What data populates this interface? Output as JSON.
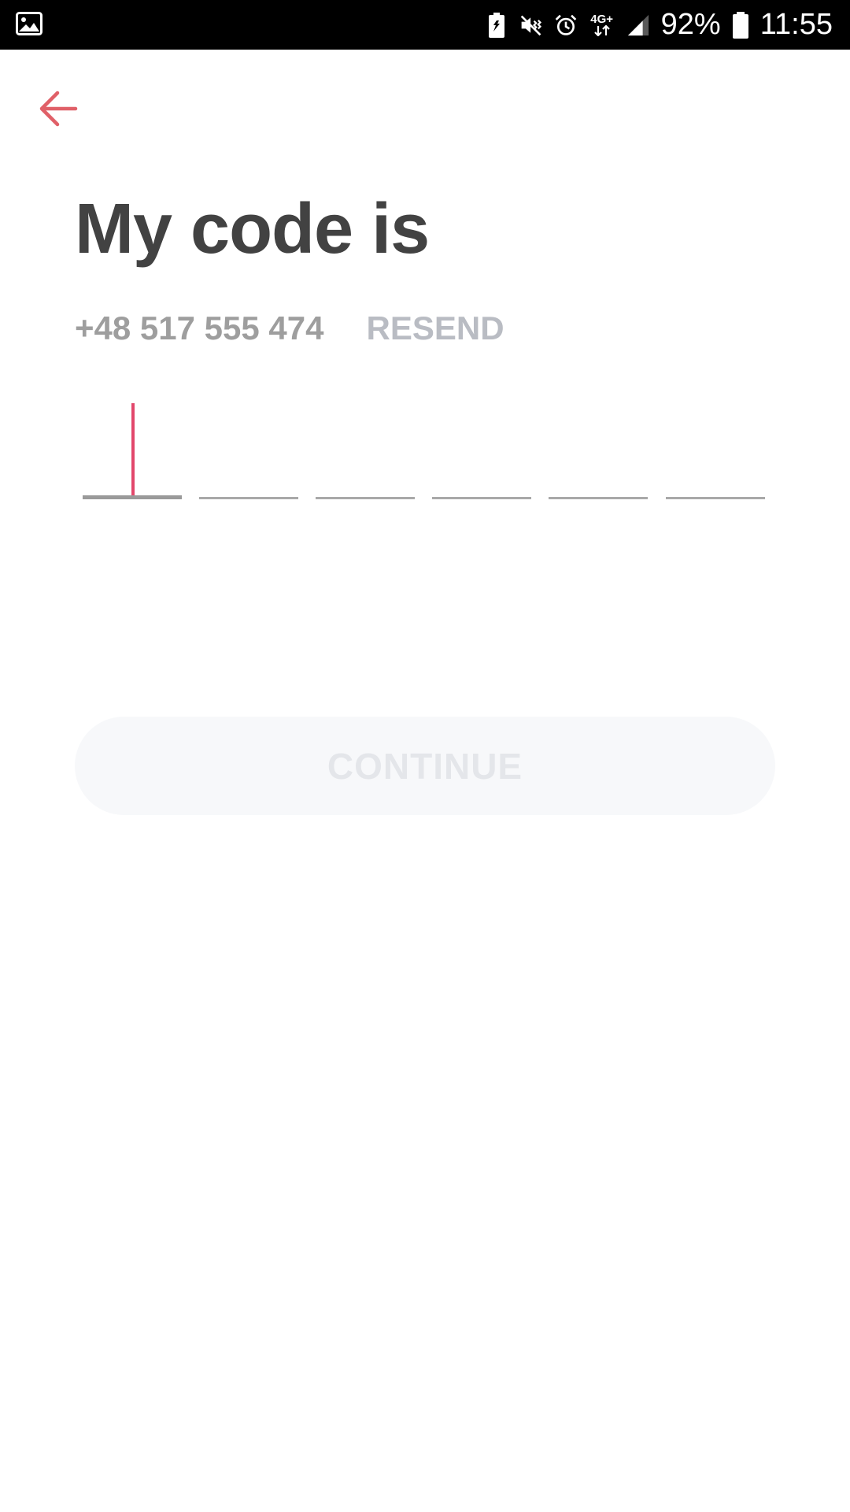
{
  "status_bar": {
    "battery_percent": "92%",
    "time": "11:55",
    "network_type": "4G+",
    "icons": [
      "image-icon",
      "battery-saver-icon",
      "mute-vibrate-icon",
      "alarm-icon",
      "network-4g-icon",
      "signal-icon",
      "battery-icon"
    ]
  },
  "header": {
    "back_icon": "arrow-left-icon",
    "title": "My code is"
  },
  "phone": {
    "number": "+48 517 555 474",
    "resend_label": "RESEND"
  },
  "code_input": {
    "digits": [
      "",
      "",
      "",
      "",
      "",
      ""
    ],
    "active_index": 0
  },
  "actions": {
    "continue_label": "CONTINUE"
  },
  "colors": {
    "accent": "#e2476b",
    "title": "#424242",
    "muted": "#9e9e9e",
    "disabled_button_bg": "#f7f8fa",
    "disabled_button_text": "#e4e6ea"
  }
}
